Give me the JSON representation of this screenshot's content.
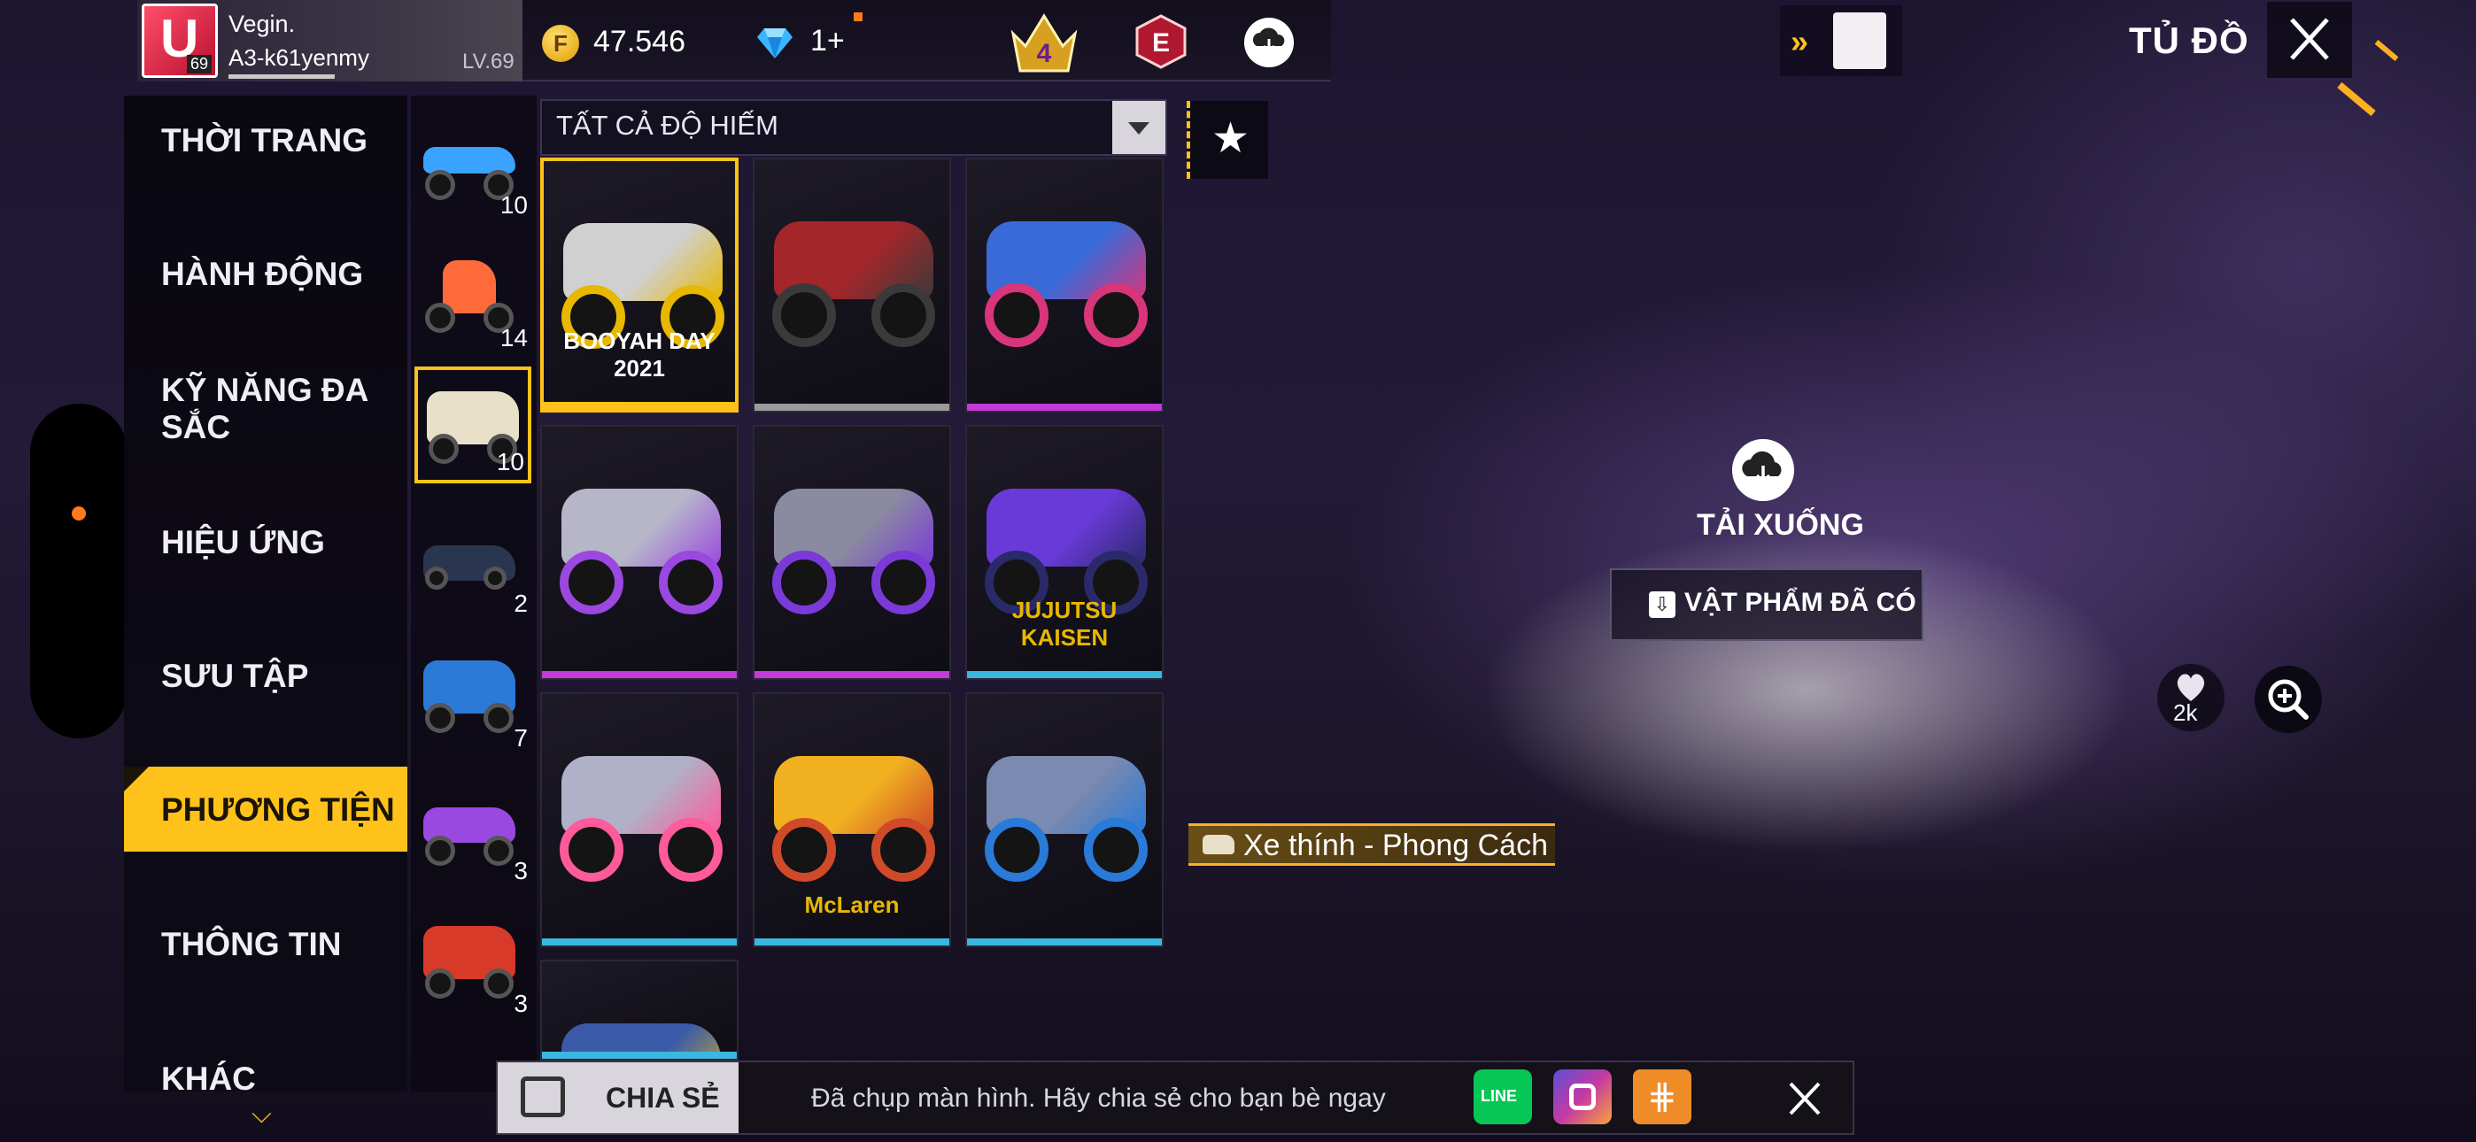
{
  "profile": {
    "name": "Vegin.",
    "username": "A3-k61yenmy",
    "level": "LV.69",
    "avatar_level": "69",
    "avatar_glyph": "U"
  },
  "currency": {
    "gold": "47.546",
    "diamonds": "1+"
  },
  "header": {
    "rank_badge": "4",
    "e_badge": "E",
    "title": "TỦ ĐỒ",
    "forward_chevron": "»"
  },
  "nav": {
    "items": [
      {
        "label": "THỜI TRANG"
      },
      {
        "label": "HÀNH ĐỘNG"
      },
      {
        "label": "KỸ NĂNG ĐA SẮC"
      },
      {
        "label": "HIỆU ỨNG"
      },
      {
        "label": "SƯU TẬP"
      },
      {
        "label": "PHƯƠNG TIỆN",
        "active": true
      },
      {
        "label": "THÔNG TIN"
      },
      {
        "label": "KHÁC"
      }
    ],
    "more_icon": "chevron-down-icon"
  },
  "categories": [
    {
      "count": "10",
      "color": "#3aa3ff"
    },
    {
      "count": "14",
      "color": "#ff6a3a"
    },
    {
      "count": "10",
      "color": "#e8e0c8",
      "selected": true
    },
    {
      "count": "2",
      "color": "#2a3550"
    },
    {
      "count": "7",
      "color": "#2c7ad8"
    },
    {
      "count": "3",
      "color": "#9a48e0"
    },
    {
      "count": "3",
      "color": "#d83a2a"
    }
  ],
  "filter": {
    "label": "TẤT CẢ ĐỘ HIẾM"
  },
  "grid": {
    "items": [
      {
        "tag": "BOOYAH DAY 2021",
        "body": "#d0d0d0",
        "accent": "#e8b800",
        "rarity": "#ffc21a",
        "selected": true
      },
      {
        "tag": "",
        "body": "#a3262b",
        "accent": "#3a3a3a",
        "rarity": "#9a9a9a"
      },
      {
        "tag": "",
        "body": "#3a6ad8",
        "accent": "#d8357a",
        "rarity": "#c43ad8"
      },
      {
        "tag": "",
        "body": "#b6b6c8",
        "accent": "#9a48e0",
        "rarity": "#c43ad8"
      },
      {
        "tag": "",
        "body": "#8a8aa0",
        "accent": "#7a3ad8",
        "rarity": "#c43ad8"
      },
      {
        "tag": "JUJUTSU KAISEN",
        "body": "#6a3ad8",
        "accent": "#2a2a6a",
        "rarity": "#3ab8e0"
      },
      {
        "tag": "",
        "body": "#b0b0c8",
        "accent": "#ff5a9a",
        "rarity": "#3ab8e0"
      },
      {
        "tag": "McLaren",
        "body": "#f0b020",
        "accent": "#d04a2a",
        "rarity": "#3ab8e0"
      },
      {
        "tag": "",
        "body": "#7a8ab0",
        "accent": "#2a7ad8",
        "rarity": "#3ab8e0"
      },
      {
        "tag": "",
        "body": "#3a5aa8",
        "accent": "#d8b020",
        "rarity": "#3ab8e0"
      }
    ]
  },
  "detail": {
    "download_label": "TẢI XUỐNG",
    "owned_label": "VẬT PHẨM ĐÃ CÓ",
    "likes": "2k",
    "item_name": "Xe thính - Phong Cách"
  },
  "share": {
    "button_label": "CHIA SẺ",
    "message": "Đã chụp màn hình. Hãy chia sẻ cho bạn bè ngay",
    "line_label": "LINE"
  },
  "colors": {
    "accent": "#ffc21a",
    "panel": "#0c0a14"
  }
}
